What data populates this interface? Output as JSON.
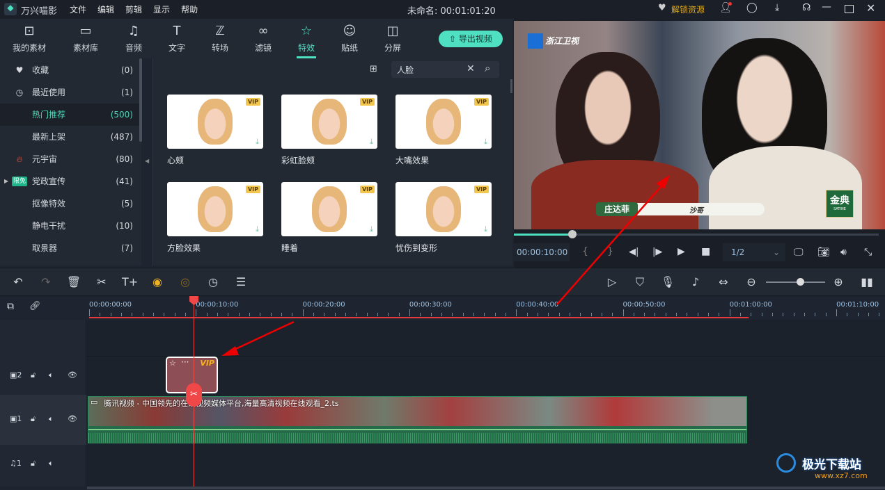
{
  "app": {
    "name": "万兴喵影",
    "menu": [
      "文件",
      "编辑",
      "剪辑",
      "显示",
      "帮助"
    ],
    "project_title": "未命名: 00:01:01:20",
    "unlock_label": "解锁资源",
    "accent": "#4fe0c2"
  },
  "tabs": [
    {
      "label": "我的素材",
      "icon": "media-box-icon"
    },
    {
      "label": "素材库",
      "icon": "folder-icon"
    },
    {
      "label": "音频",
      "icon": "music-note-icon"
    },
    {
      "label": "文字",
      "icon": "text-icon"
    },
    {
      "label": "转场",
      "icon": "transition-icon"
    },
    {
      "label": "滤镜",
      "icon": "filter-icon"
    },
    {
      "label": "特效",
      "icon": "magic-wand-icon",
      "active": true
    },
    {
      "label": "贴纸",
      "icon": "sticker-icon"
    },
    {
      "label": "分屏",
      "icon": "split-screen-icon"
    }
  ],
  "export_label": "导出视频",
  "categories": [
    {
      "name": "收藏",
      "count": "(0)",
      "icon": "heart-icon"
    },
    {
      "name": "最近使用",
      "count": "(1)",
      "icon": "clock-icon"
    },
    {
      "name": "热门推荐",
      "count": "(500)",
      "selected": true
    },
    {
      "name": "最新上架",
      "count": "(487)"
    },
    {
      "name": "元宇宙",
      "count": "(80)",
      "icon": "fire-icon"
    },
    {
      "name": "党政宣传",
      "count": "(41)",
      "badge": "限免"
    },
    {
      "name": "抠像特效",
      "count": "(5)"
    },
    {
      "name": "静电干扰",
      "count": "(10)"
    },
    {
      "name": "取景器",
      "count": "(7)"
    }
  ],
  "search": {
    "value": "人脸"
  },
  "effects": [
    {
      "label": "心颊",
      "badge": "VIP"
    },
    {
      "label": "彩虹脸颊",
      "badge": "VIP"
    },
    {
      "label": "大嘴效果",
      "badge": "VIP"
    },
    {
      "label": "方脸效果",
      "badge": "VIP"
    },
    {
      "label": "睡着",
      "badge": "VIP"
    },
    {
      "label": "忧伤到变形",
      "badge": "VIP"
    }
  ],
  "preview": {
    "channel_logo": "浙江卫视",
    "name_tag": "庄达菲",
    "name_tag2": "沙哥",
    "sponsor": "金典",
    "sponsor_sub": "SATINE",
    "timecode": "00:00:10:00",
    "quality": "1/2",
    "progress": 0.16
  },
  "ruler": [
    "00:00:00:00",
    "00:00:10:00",
    "00:00:20:00",
    "00:00:30:00",
    "00:00:40:00",
    "00:00:50:00",
    "00:01:00:00",
    "00:01:10:00"
  ],
  "tracks": [
    {
      "label": "2",
      "type": "video"
    },
    {
      "label": "1",
      "type": "video"
    },
    {
      "label": "1",
      "type": "audio"
    }
  ],
  "clips": {
    "effect_badge": "VIP",
    "effect_dots": "···",
    "video_title": "腾讯视频 - 中国领先的在线视频媒体平台,海量高清视频在线观看_2.ts"
  },
  "playhead": "00:00:10:00",
  "watermark": "极光下载站",
  "watermark_url": "www.xz7.com"
}
